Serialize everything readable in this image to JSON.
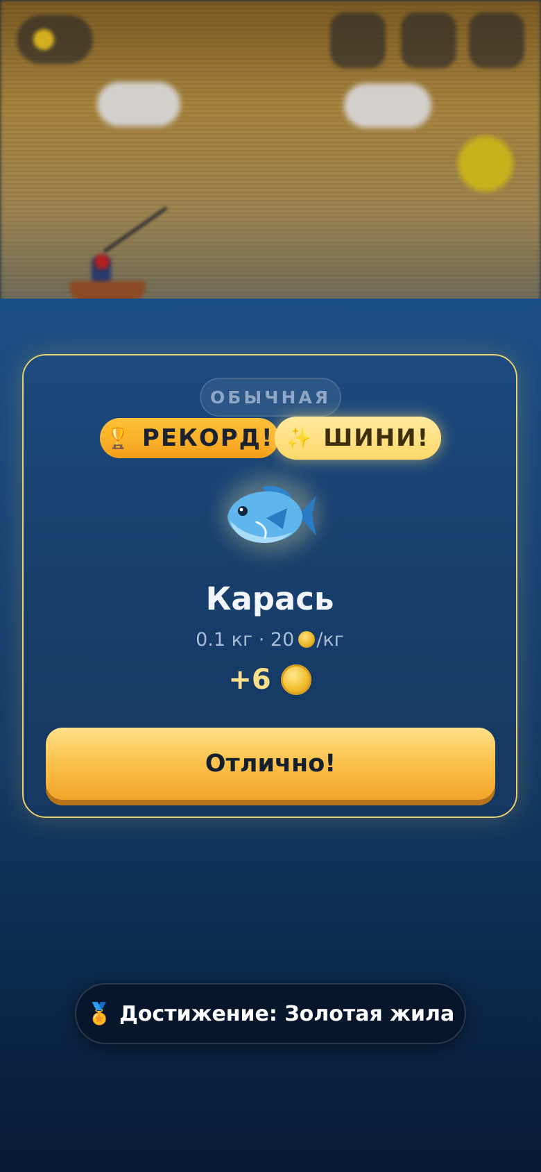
{
  "colors": {
    "accent_gold": "#fbc14a",
    "modal_border": "#e8d070",
    "water": "#174577"
  },
  "modal": {
    "rarity_label": "ОБЫЧНАЯ",
    "badges": {
      "record": {
        "icon": "trophy-icon",
        "glyph": "🏆",
        "label": "РЕКОРД!"
      },
      "shiny": {
        "icon": "sparkles-icon",
        "glyph": "✨",
        "label": "ШИНИ!"
      }
    },
    "fish": {
      "icon": "fish-icon",
      "name": "Карась",
      "weight": "0.1 кг",
      "separator": "·",
      "price": "20",
      "price_unit": "/кг"
    },
    "reward": {
      "amount": "+6",
      "icon": "coin-icon"
    },
    "confirm_label": "Отлично!"
  },
  "toast": {
    "icon": "medal-icon",
    "glyph": "🏅",
    "text": "Достижение: Золотая жила"
  }
}
